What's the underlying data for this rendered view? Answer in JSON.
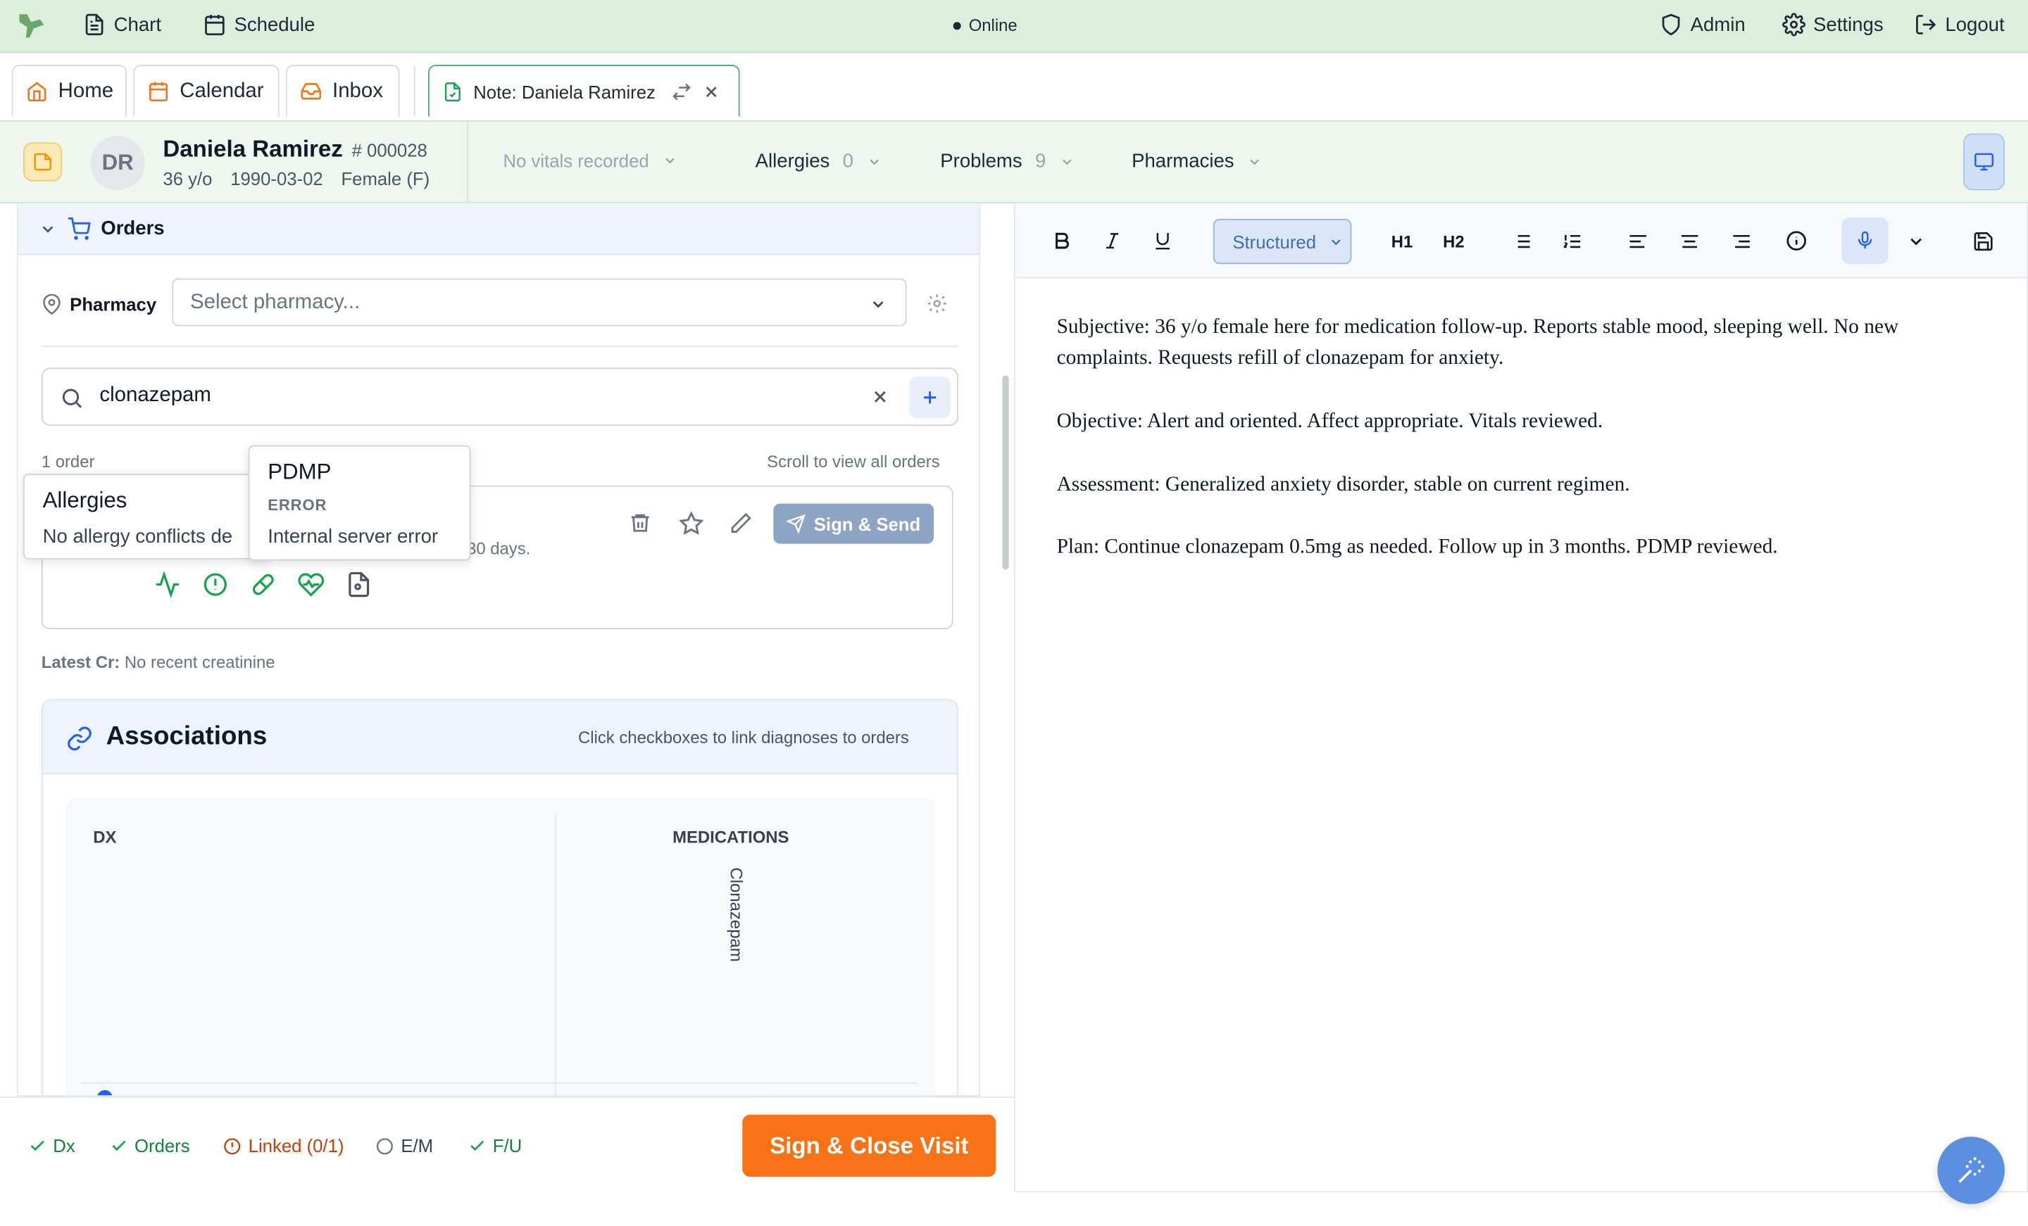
{
  "topbar": {
    "nav": [
      "Chart",
      "Schedule"
    ],
    "status": "Online",
    "right": [
      "Admin",
      "Settings",
      "Logout"
    ]
  },
  "tabs": {
    "home": "Home",
    "calendar": "Calendar",
    "inbox": "Inbox",
    "note": "Note: Daniela Ramirez"
  },
  "patient": {
    "initials": "DR",
    "name": "Daniela Ramirez",
    "id": "# 000028",
    "age": "36 y/o",
    "dob": "1990-03-02",
    "sex": "Female (F)",
    "vitals": "No vitals recorded",
    "allergies_label": "Allergies",
    "allergies_count": "0",
    "problems_label": "Problems",
    "problems_count": "9",
    "pharmacies_label": "Pharmacies"
  },
  "orders": {
    "title": "Orders",
    "pharmacy_label": "Pharmacy",
    "pharmacy_placeholder": "Select pharmacy...",
    "search_value": "clonazepam",
    "order_count": "1 order",
    "scroll_hint": "Scroll to view all orders",
    "card_days_fragment": "30 days.",
    "sign_send": "Sign & Send",
    "latest_cr_label": "Latest Cr:",
    "latest_cr_value": "No recent creatinine"
  },
  "tooltips": {
    "allergies_title": "Allergies",
    "allergies_text": "No allergy conflicts de",
    "pdmp_title": "PDMP",
    "pdmp_status": "ERROR",
    "pdmp_text": "Internal server error"
  },
  "associations": {
    "title": "Associations",
    "hint": "Click checkboxes to link diagnoses to orders",
    "col_dx": "DX",
    "col_meds": "MEDICATIONS",
    "med_1": "Clonazepam"
  },
  "bottombar": {
    "dx": "Dx",
    "orders": "Orders",
    "linked": "Linked (0/1)",
    "em": "E/M",
    "fu": "F/U",
    "sign_close": "Sign & Close Visit"
  },
  "editor": {
    "mode": "Structured",
    "h1": "H1",
    "h2": "H2",
    "paragraphs": [
      "Subjective: 36 y/o female here for medication follow-up. Reports stable mood, sleeping well. No new complaints. Requests refill of clonazepam for anxiety.",
      "Objective: Alert and oriented. Affect appropriate. Vitals reviewed.",
      "Assessment: Generalized anxiety disorder, stable on current regimen.",
      "Plan: Continue clonazepam 0.5mg as needed. Follow up in 3 months. PDMP reviewed."
    ]
  },
  "colors": {
    "topbar_bg": "#dcefdc",
    "accent_orange": "#f97316",
    "accent_blue": "#2563eb",
    "success_green": "#16a34a",
    "warning_orange": "#c2410c"
  }
}
